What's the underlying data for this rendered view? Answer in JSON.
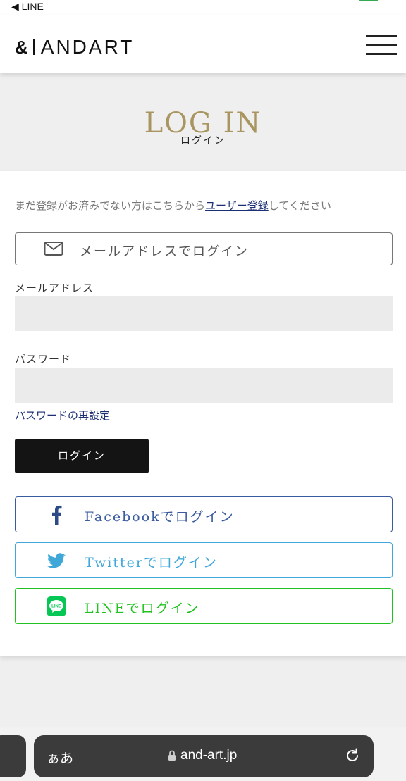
{
  "status_bar": {
    "back_label": "◀ LINE"
  },
  "header": {
    "logo_amp": "&",
    "logo_word": "ANDART",
    "menu_icon": "hamburger-menu-icon"
  },
  "title": {
    "en": "LOG IN",
    "jp": "ログイン"
  },
  "register_note": {
    "prefix": "まだ登録がお済みでない方はこちらから",
    "link": "ユーザー登録",
    "suffix": "してください"
  },
  "email_login_button": {
    "label": "メールアドレスでログイン",
    "icon": "mail-icon"
  },
  "form": {
    "email_label": "メールアドレス",
    "email_value": "",
    "password_label": "パスワード",
    "password_value": "",
    "reset_link": "パスワードの再設定",
    "login_button": "ログイン"
  },
  "social": {
    "facebook": {
      "label": "Facebookでログイン",
      "icon": "facebook-icon",
      "color": "#3a5ba0"
    },
    "twitter": {
      "label": "Twitterでログイン",
      "icon": "twitter-icon",
      "color": "#3fa8d8"
    },
    "line": {
      "label": "LINEでログイン",
      "icon": "line-icon",
      "color": "#21c21f"
    }
  },
  "browser": {
    "text_size": "ぁあ",
    "host": "and-art.jp"
  },
  "colors": {
    "title_gold": "#a89560",
    "link_navy": "#1c2f74",
    "button_black": "#141414"
  }
}
